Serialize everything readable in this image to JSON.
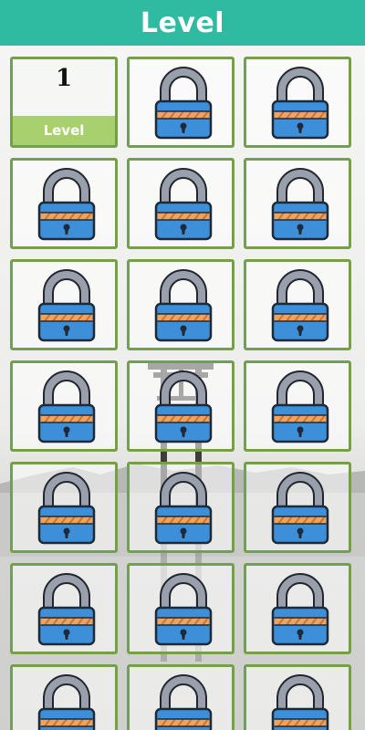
{
  "header": {
    "title": "Level"
  },
  "levels": [
    {
      "number": "1",
      "label": "Level",
      "locked": false
    },
    {
      "locked": true
    },
    {
      "locked": true
    },
    {
      "locked": true
    },
    {
      "locked": true
    },
    {
      "locked": true
    },
    {
      "locked": true
    },
    {
      "locked": true
    },
    {
      "locked": true
    },
    {
      "locked": true
    },
    {
      "locked": true
    },
    {
      "locked": true
    },
    {
      "locked": true
    },
    {
      "locked": true
    },
    {
      "locked": true
    },
    {
      "locked": true
    },
    {
      "locked": true
    },
    {
      "locked": true
    },
    {
      "locked": true
    },
    {
      "locked": true
    },
    {
      "locked": true
    }
  ],
  "icons": {
    "locked": "padlock-icon"
  },
  "colors": {
    "header": "#2fbba2",
    "cell_border": "#75a04a",
    "level_label_bg": "#a9d06f",
    "lock_body": "#3d8fd9",
    "lock_shackle": "#9aa0ab",
    "lock_stripe": "#f0a35c"
  }
}
